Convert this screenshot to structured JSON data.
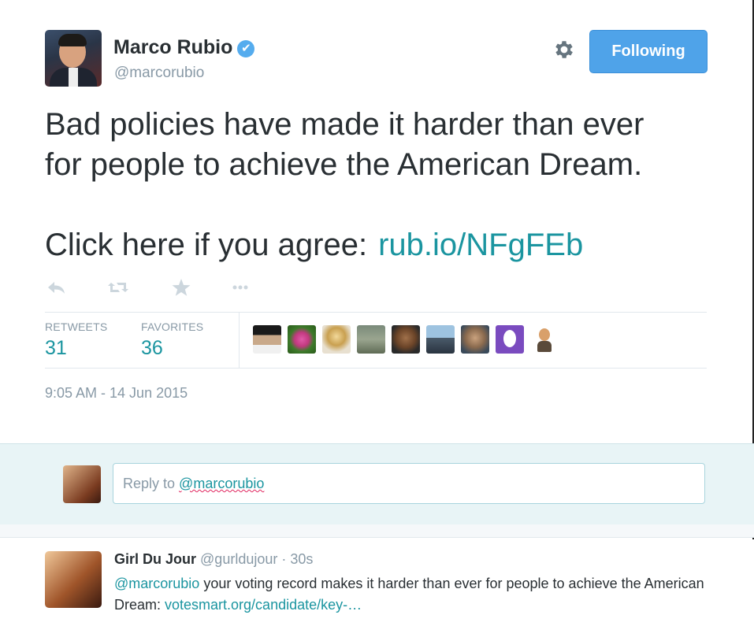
{
  "author": {
    "name": "Marco Rubio",
    "handle": "@marcorubio",
    "verified_glyph": "✔"
  },
  "follow_button": {
    "label": "Following",
    "color": "#4fa3e9"
  },
  "tweet": {
    "line1": "Bad policies have made it harder than ever",
    "line2": "for people to achieve the American Dream.",
    "cta": "Click here if you agree:",
    "link": "rub.io/NFgFEb",
    "timestamp": "9:05 AM - 14 Jun 2015"
  },
  "stats": {
    "retweets_label": "RETWEETS",
    "retweets_value": "31",
    "favorites_label": "FAVORITES",
    "favorites_value": "36"
  },
  "icons": {
    "reply": "reply-icon",
    "retweet": "retweet-icon",
    "favorite": "star-icon",
    "more": "more-icon",
    "settings": "gear-icon"
  },
  "reply_box": {
    "prefix": "Reply to ",
    "mention": "@marcorubio"
  },
  "reply_tweet": {
    "name": "Girl Du Jour",
    "handle": "@gurldujour",
    "time": "· 30s",
    "mention": "@marcorubio",
    "text": " your voting record makes it harder than ever for people to achieve the American Dream: ",
    "link": "votesmart.org/candidate/key-…"
  },
  "colors": {
    "link": "#1b95a0",
    "muted": "#8899a6",
    "text": "#292f33",
    "reply_bar": "#e8f4f6"
  }
}
